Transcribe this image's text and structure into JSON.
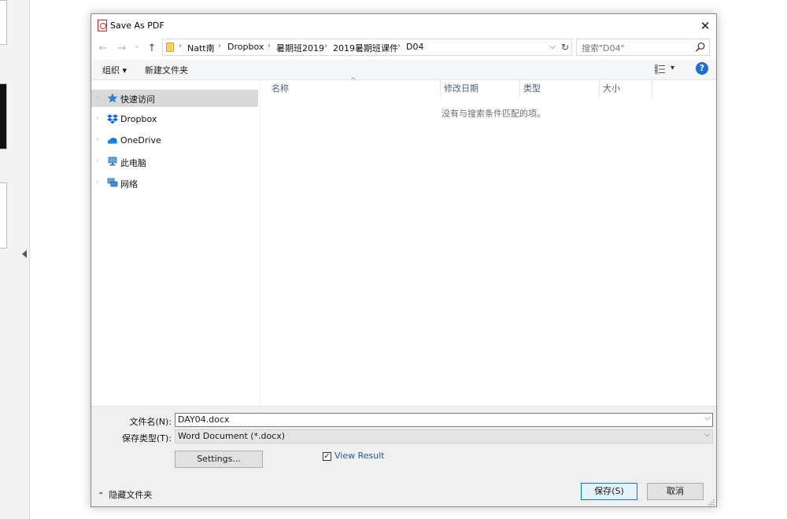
{
  "dialog": {
    "title": "Save As PDF",
    "close_symbol": "✕",
    "icons": {
      "title": "pdf-file-icon",
      "close": "close-icon"
    }
  },
  "address": {
    "back_symbol": "←",
    "forward_symbol": "→",
    "recent_symbol": "⌄",
    "up_symbol": "↑",
    "breadcrumbs": [
      "Natt南",
      "Dropbox",
      "暑期班2019",
      "2019暑期班课件",
      "D04"
    ],
    "separator": "›",
    "dropdown_symbol": "⌵",
    "refresh_symbol": "↻"
  },
  "search": {
    "placeholder": "搜索\"D04\""
  },
  "toolbar": {
    "organize_label": "组织 ▾",
    "new_folder_label": "新建文件夹",
    "view_dropdown_symbol": "▾",
    "help_symbol": "?"
  },
  "nav": {
    "items": [
      {
        "label": "快速访问",
        "icon": "star-icon",
        "selected": true
      },
      {
        "label": "Dropbox",
        "icon": "dropbox-icon",
        "selected": false
      },
      {
        "label": "OneDrive",
        "icon": "cloud-icon",
        "selected": false
      },
      {
        "label": "此电脑",
        "icon": "computer-icon",
        "selected": false
      },
      {
        "label": "网络",
        "icon": "network-icon",
        "selected": false
      }
    ],
    "expander_symbol": "›"
  },
  "file_list": {
    "columns": [
      "名称",
      "修改日期",
      "类型",
      "大小"
    ],
    "sort_symbol": "^",
    "empty_message": "没有与搜索条件匹配的项。"
  },
  "form": {
    "filename_label": "文件名(N):",
    "filename_value": "DAY04.docx",
    "filetype_label": "保存类型(T):",
    "filetype_value": "Word Document (*.docx)",
    "dropdown_symbol": "⌵",
    "settings_label": "Settings...",
    "view_result_label": "View Result",
    "view_result_checked": true,
    "check_symbol": "✓",
    "hide_folders_label": "隐藏文件夹",
    "hide_folders_symbol": "⌃",
    "save_label": "保存(S)",
    "cancel_label": "取消"
  },
  "colors": {
    "accent": "#0078d7",
    "help": "#1f6fd1",
    "link": "#1a5fb4",
    "selection": "#d9d9d9"
  }
}
